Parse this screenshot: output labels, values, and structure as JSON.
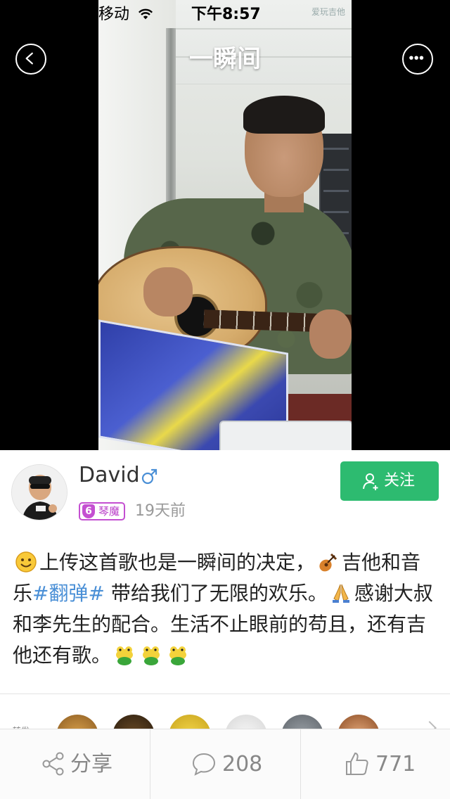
{
  "status_bar": {
    "carrier": "移动",
    "time": "下午8:57",
    "corner_watermark": "爱玩吉他"
  },
  "nav": {
    "title": "一瞬间",
    "back_icon": "chevron-left-icon",
    "more_icon": "more-horizontal-icon"
  },
  "user": {
    "name": "David",
    "gender_icon": "male-icon",
    "level": "6",
    "level_title": "琴魔",
    "posted": "19天前",
    "follow_label": "关注"
  },
  "post": {
    "part1": "上传这首歌也是一瞬间的决定，",
    "part2": "吉他和音乐",
    "hashtag": "#翻弹#",
    "part3": " 带给我们了无限的欢乐。",
    "part4": "感谢大叔和李先生的配合。生活不止眼前的苟且，还有吉他还有歌。",
    "emojis": [
      "smile-emoji",
      "guitar-emoji",
      "pray-emoji",
      "frog-emoji",
      "frog-emoji",
      "frog-emoji"
    ]
  },
  "likers": {
    "label": "转发"
  },
  "actions": {
    "share_label": "分享",
    "comments_count": "208",
    "likes_count": "771"
  },
  "colors": {
    "accent_green": "#2dbb70",
    "hashtag_blue": "#4a8fd6",
    "level_purple": "#c44fd1"
  }
}
